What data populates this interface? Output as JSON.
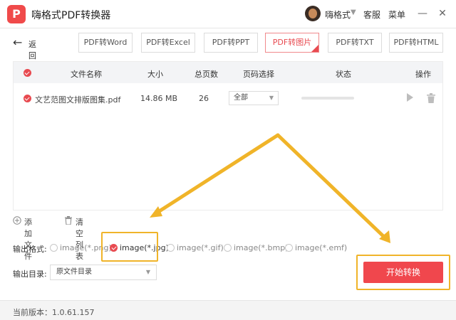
{
  "app": {
    "title": "嗨格式PDF转换器",
    "logo_letter": "P"
  },
  "user": {
    "name": "嗨格式"
  },
  "titlebar": {
    "support": "客服",
    "menu": "菜单",
    "minimize": "—",
    "close": "✕"
  },
  "toolbar": {
    "back_label": "返回",
    "tabs": [
      {
        "label": "PDF转Word"
      },
      {
        "label": "PDF转Excel"
      },
      {
        "label": "PDF转PPT"
      },
      {
        "label": "PDF转图片",
        "active": true
      },
      {
        "label": "PDF转TXT"
      },
      {
        "label": "PDF转HTML"
      }
    ]
  },
  "table": {
    "headers": {
      "name": "文件名称",
      "size": "大小",
      "pages": "总页数",
      "range": "页码选择",
      "status": "状态",
      "actions": "操作"
    },
    "rows": [
      {
        "name": "文艺范图文排版图集.pdf",
        "size": "14.86 MB",
        "pages": "26",
        "range": "全部",
        "progress": 0
      }
    ]
  },
  "actions": {
    "add_file": "添加文件",
    "clear_list": "清空列表"
  },
  "output": {
    "format_label": "输出格式:",
    "formats": [
      {
        "label": "image(*.png)",
        "checked": false
      },
      {
        "label": "image(*.jpg)",
        "checked": true
      },
      {
        "label": "image(*.gif)",
        "checked": false
      },
      {
        "label": "image(*.bmp)",
        "checked": false
      },
      {
        "label": "image(*.emf)",
        "checked": false
      }
    ],
    "dir_label": "输出目录:",
    "dir_value": "原文件目录"
  },
  "start_button": "开始转换",
  "footer": {
    "version": "当前版本：1.0.61.157"
  },
  "colors": {
    "accent": "#e84a50",
    "highlight": "#f0b429"
  }
}
